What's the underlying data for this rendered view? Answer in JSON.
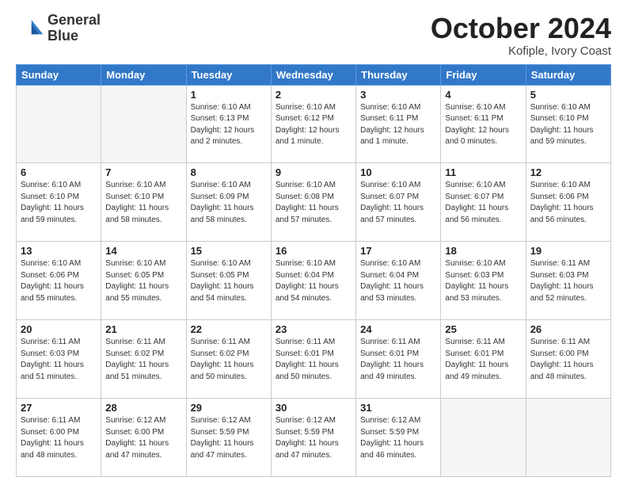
{
  "header": {
    "logo_line1": "General",
    "logo_line2": "Blue",
    "month": "October 2024",
    "location": "Kofiple, Ivory Coast"
  },
  "days_of_week": [
    "Sunday",
    "Monday",
    "Tuesday",
    "Wednesday",
    "Thursday",
    "Friday",
    "Saturday"
  ],
  "weeks": [
    [
      {
        "day": "",
        "content": ""
      },
      {
        "day": "",
        "content": ""
      },
      {
        "day": "1",
        "content": "Sunrise: 6:10 AM\nSunset: 6:13 PM\nDaylight: 12 hours\nand 2 minutes."
      },
      {
        "day": "2",
        "content": "Sunrise: 6:10 AM\nSunset: 6:12 PM\nDaylight: 12 hours\nand 1 minute."
      },
      {
        "day": "3",
        "content": "Sunrise: 6:10 AM\nSunset: 6:11 PM\nDaylight: 12 hours\nand 1 minute."
      },
      {
        "day": "4",
        "content": "Sunrise: 6:10 AM\nSunset: 6:11 PM\nDaylight: 12 hours\nand 0 minutes."
      },
      {
        "day": "5",
        "content": "Sunrise: 6:10 AM\nSunset: 6:10 PM\nDaylight: 11 hours\nand 59 minutes."
      }
    ],
    [
      {
        "day": "6",
        "content": "Sunrise: 6:10 AM\nSunset: 6:10 PM\nDaylight: 11 hours\nand 59 minutes."
      },
      {
        "day": "7",
        "content": "Sunrise: 6:10 AM\nSunset: 6:10 PM\nDaylight: 11 hours\nand 58 minutes."
      },
      {
        "day": "8",
        "content": "Sunrise: 6:10 AM\nSunset: 6:09 PM\nDaylight: 11 hours\nand 58 minutes."
      },
      {
        "day": "9",
        "content": "Sunrise: 6:10 AM\nSunset: 6:08 PM\nDaylight: 11 hours\nand 57 minutes."
      },
      {
        "day": "10",
        "content": "Sunrise: 6:10 AM\nSunset: 6:07 PM\nDaylight: 11 hours\nand 57 minutes."
      },
      {
        "day": "11",
        "content": "Sunrise: 6:10 AM\nSunset: 6:07 PM\nDaylight: 11 hours\nand 56 minutes."
      },
      {
        "day": "12",
        "content": "Sunrise: 6:10 AM\nSunset: 6:06 PM\nDaylight: 11 hours\nand 56 minutes."
      }
    ],
    [
      {
        "day": "13",
        "content": "Sunrise: 6:10 AM\nSunset: 6:06 PM\nDaylight: 11 hours\nand 55 minutes."
      },
      {
        "day": "14",
        "content": "Sunrise: 6:10 AM\nSunset: 6:05 PM\nDaylight: 11 hours\nand 55 minutes."
      },
      {
        "day": "15",
        "content": "Sunrise: 6:10 AM\nSunset: 6:05 PM\nDaylight: 11 hours\nand 54 minutes."
      },
      {
        "day": "16",
        "content": "Sunrise: 6:10 AM\nSunset: 6:04 PM\nDaylight: 11 hours\nand 54 minutes."
      },
      {
        "day": "17",
        "content": "Sunrise: 6:10 AM\nSunset: 6:04 PM\nDaylight: 11 hours\nand 53 minutes."
      },
      {
        "day": "18",
        "content": "Sunrise: 6:10 AM\nSunset: 6:03 PM\nDaylight: 11 hours\nand 53 minutes."
      },
      {
        "day": "19",
        "content": "Sunrise: 6:11 AM\nSunset: 6:03 PM\nDaylight: 11 hours\nand 52 minutes."
      }
    ],
    [
      {
        "day": "20",
        "content": "Sunrise: 6:11 AM\nSunset: 6:03 PM\nDaylight: 11 hours\nand 51 minutes."
      },
      {
        "day": "21",
        "content": "Sunrise: 6:11 AM\nSunset: 6:02 PM\nDaylight: 11 hours\nand 51 minutes."
      },
      {
        "day": "22",
        "content": "Sunrise: 6:11 AM\nSunset: 6:02 PM\nDaylight: 11 hours\nand 50 minutes."
      },
      {
        "day": "23",
        "content": "Sunrise: 6:11 AM\nSunset: 6:01 PM\nDaylight: 11 hours\nand 50 minutes."
      },
      {
        "day": "24",
        "content": "Sunrise: 6:11 AM\nSunset: 6:01 PM\nDaylight: 11 hours\nand 49 minutes."
      },
      {
        "day": "25",
        "content": "Sunrise: 6:11 AM\nSunset: 6:01 PM\nDaylight: 11 hours\nand 49 minutes."
      },
      {
        "day": "26",
        "content": "Sunrise: 6:11 AM\nSunset: 6:00 PM\nDaylight: 11 hours\nand 48 minutes."
      }
    ],
    [
      {
        "day": "27",
        "content": "Sunrise: 6:11 AM\nSunset: 6:00 PM\nDaylight: 11 hours\nand 48 minutes."
      },
      {
        "day": "28",
        "content": "Sunrise: 6:12 AM\nSunset: 6:00 PM\nDaylight: 11 hours\nand 47 minutes."
      },
      {
        "day": "29",
        "content": "Sunrise: 6:12 AM\nSunset: 5:59 PM\nDaylight: 11 hours\nand 47 minutes."
      },
      {
        "day": "30",
        "content": "Sunrise: 6:12 AM\nSunset: 5:59 PM\nDaylight: 11 hours\nand 47 minutes."
      },
      {
        "day": "31",
        "content": "Sunrise: 6:12 AM\nSunset: 5:59 PM\nDaylight: 11 hours\nand 46 minutes."
      },
      {
        "day": "",
        "content": ""
      },
      {
        "day": "",
        "content": ""
      }
    ]
  ]
}
